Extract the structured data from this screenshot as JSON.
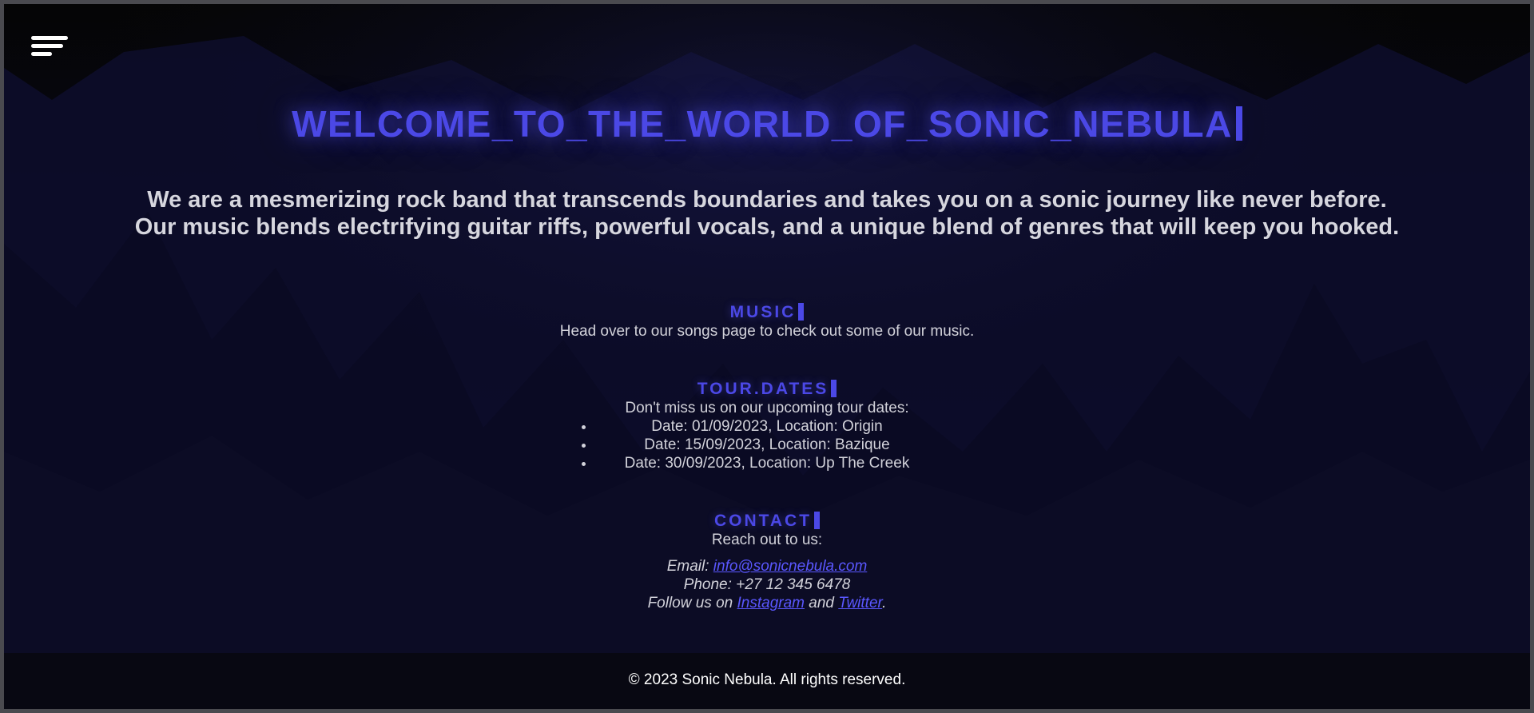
{
  "header": {
    "menu_icon": "hamburger-menu-icon"
  },
  "hero": {
    "title": "WELCOME_TO_THE_WORLD_OF_SONIC_NEBULA",
    "tagline_line1": "We are a mesmerizing rock band that transcends boundaries and takes you on a sonic journey like never before.",
    "tagline_line2": "Our music blends electrifying guitar riffs, powerful vocals, and a unique blend of genres that will keep you hooked."
  },
  "music": {
    "heading": "MUSIC",
    "text": "Head over to our songs page to check out some of our music."
  },
  "tour": {
    "heading": "TOUR.DATES",
    "intro": "Don't miss us on our upcoming tour dates:",
    "dates": [
      "Date: 01/09/2023, Location: Origin",
      "Date: 15/09/2023, Location: Bazique",
      "Date: 30/09/2023, Location: Up The Creek"
    ]
  },
  "contact": {
    "heading": "CONTACT",
    "intro": "Reach out to us:",
    "email_label": "Email: ",
    "email": "info@sonicnebula.com",
    "phone": "Phone: +27 12 345 6478",
    "follow_prefix": "Follow us on ",
    "instagram": "Instagram",
    "and": " and ",
    "twitter": "Twitter",
    "period": "."
  },
  "footer": {
    "text": "© 2023 Sonic Nebula. All rights reserved."
  },
  "colors": {
    "accent": "#4b48e6",
    "link": "#5a57ff",
    "background": "#0b0b1f",
    "text": "#d2d2da",
    "footer_bg": "#080812"
  }
}
